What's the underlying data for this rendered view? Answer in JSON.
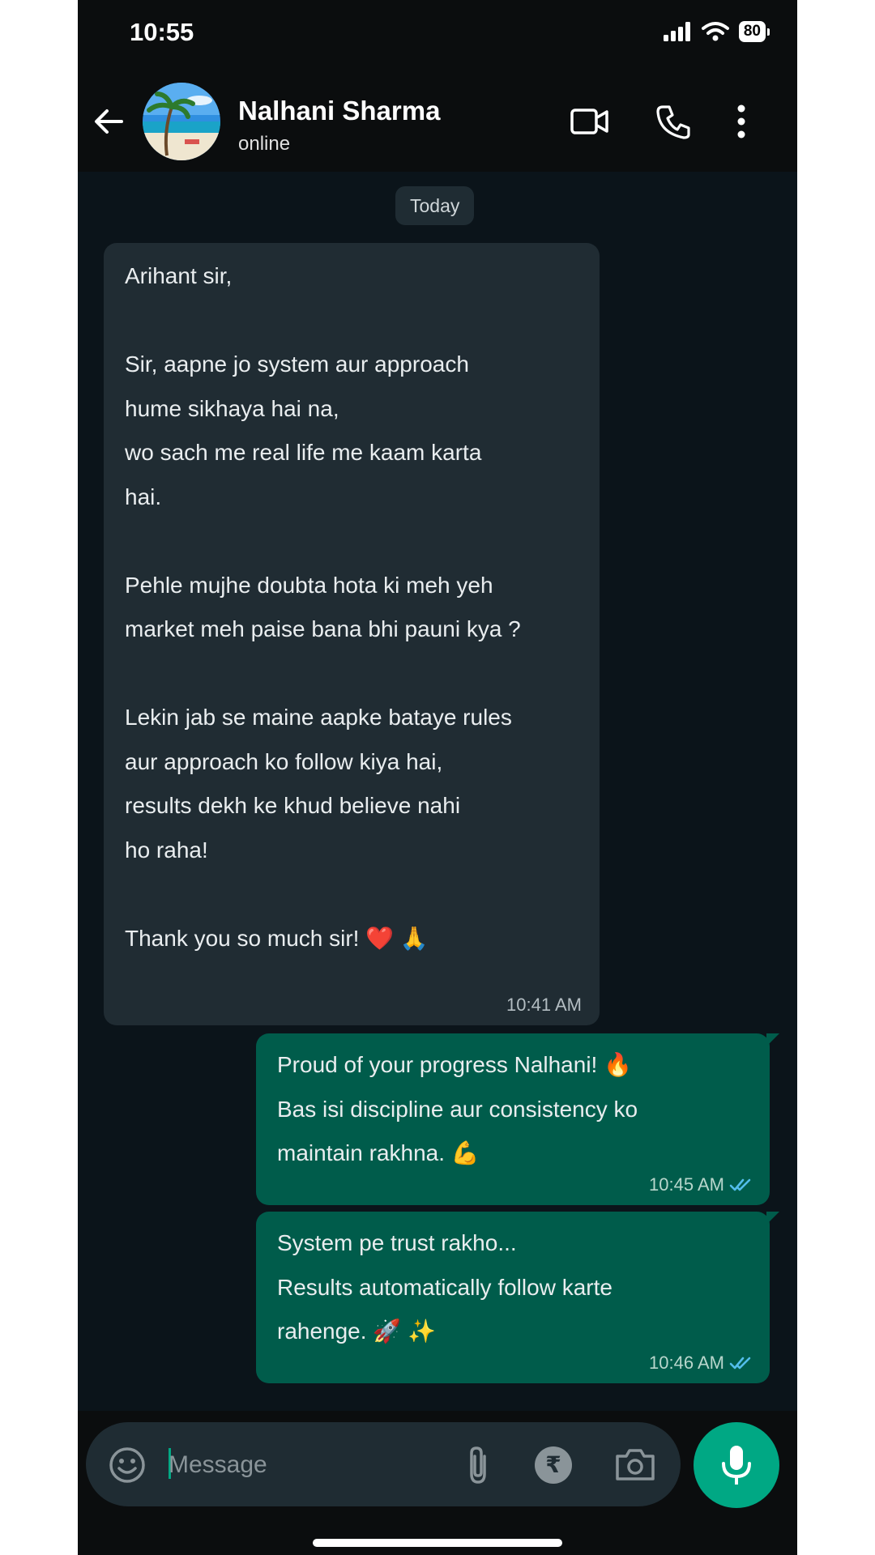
{
  "status_bar": {
    "time": "10:55",
    "battery": "80"
  },
  "header": {
    "contact_name": "Nalhani Sharma",
    "contact_status": "online"
  },
  "chat": {
    "date_chip": "Today",
    "incoming": {
      "lines": [
        "Arihant sir,",
        "",
        "Sir, aapne jo system aur approach",
        "hume sikhaya hai na,",
        "wo sach me real life me kaam karta",
        "hai.",
        "",
        "Pehle mujhe doubta hota ki meh yeh",
        "market meh paise bana bhi pauni kya ?",
        "",
        "Lekin jab se maine aapke bataye rules",
        "aur approach ko follow kiya hai,",
        "results dekh ke khud believe nahi",
        "ho raha!",
        "",
        "Thank you so much sir! ❤️ 🙏"
      ],
      "time": "10:41 AM"
    },
    "outgoing": [
      {
        "lines": [
          "Proud of your progress Nalhani! 🔥",
          "Bas isi discipline aur consistency ko",
          "maintain rakhna. 💪"
        ],
        "time": "10:45 AM"
      },
      {
        "lines": [
          "System pe trust rakho...",
          "Results automatically follow karte",
          "rahenge. 🚀 ✨"
        ],
        "time": "10:46 AM"
      }
    ]
  },
  "composer": {
    "placeholder": "Message",
    "rupee_symbol": "₹"
  },
  "icons": {
    "back": "arrow-left-icon",
    "video": "video-camera-icon",
    "phone": "phone-icon",
    "more": "vertical-dots-icon",
    "emoji": "smiley-icon",
    "attach": "paperclip-icon",
    "camera": "camera-icon",
    "mic": "microphone-icon",
    "read_receipt": "double-check-icon"
  },
  "colors": {
    "incoming_bubble": "#202c33",
    "outgoing_bubble": "#005c4b",
    "accent": "#00a884",
    "read_tick": "#53bdeb"
  }
}
